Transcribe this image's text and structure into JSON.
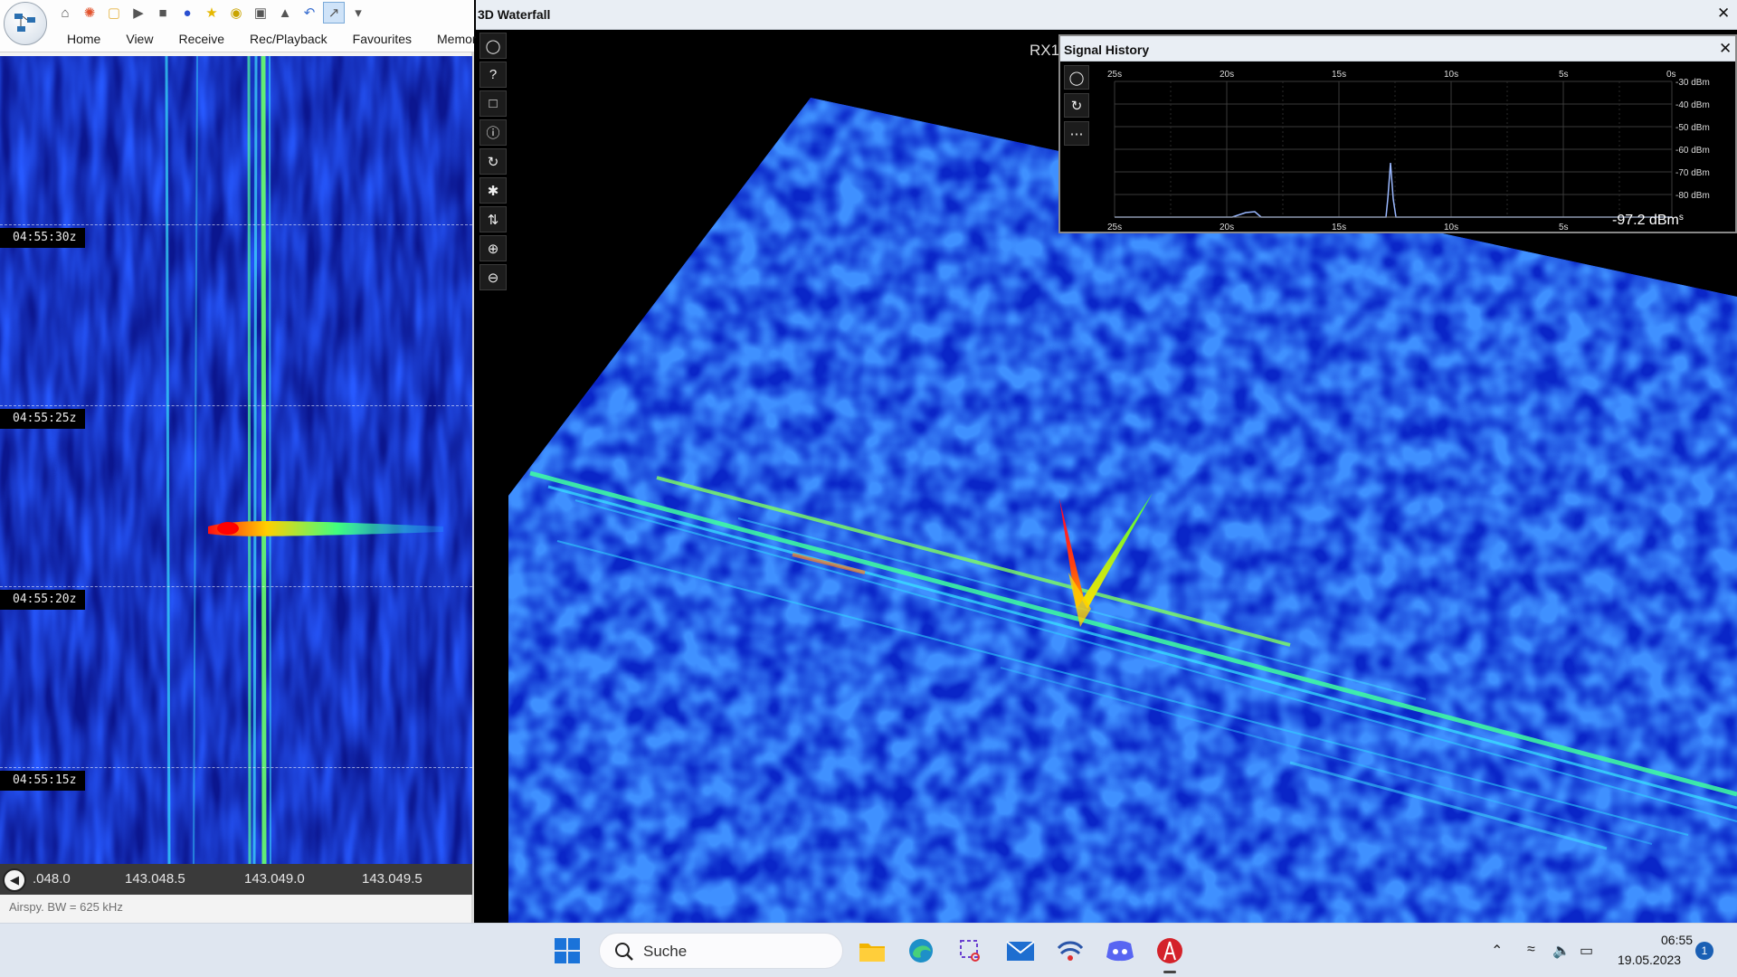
{
  "ribbon": {
    "tabs": [
      "Home",
      "View",
      "Receive",
      "Rec/Playback",
      "Favourites",
      "Memories"
    ]
  },
  "waterfall_2d": {
    "time_labels": [
      "04:55:30z",
      "04:55:25z",
      "04:55:20z",
      "04:55:15z"
    ],
    "freq_labels": [
      ".048.0",
      "143.048.5",
      "143.049.0",
      "143.049.5"
    ],
    "status": "Airspy. BW = 625 kHz"
  },
  "waterfall_3d": {
    "title": "3D Waterfall",
    "rx_label": "RX1"
  },
  "signal_history": {
    "title": "Signal History",
    "top_time_labels": [
      "25s",
      "20s",
      "15s",
      "10s",
      "5s",
      "0s"
    ],
    "bottom_time_labels": [
      "25s",
      "20s",
      "15s",
      "10s",
      "5s"
    ],
    "dbm_labels": [
      "-30 dBm",
      "-40 dBm",
      "-50 dBm",
      "-60 dBm",
      "-70 dBm",
      "-80 dBm"
    ],
    "current_value": "-97.2 dBm",
    "trailing_unit": "s"
  },
  "taskbar": {
    "search_placeholder": "Suche",
    "time": "06:55",
    "date": "19.05.2023",
    "notification_count": "1"
  }
}
